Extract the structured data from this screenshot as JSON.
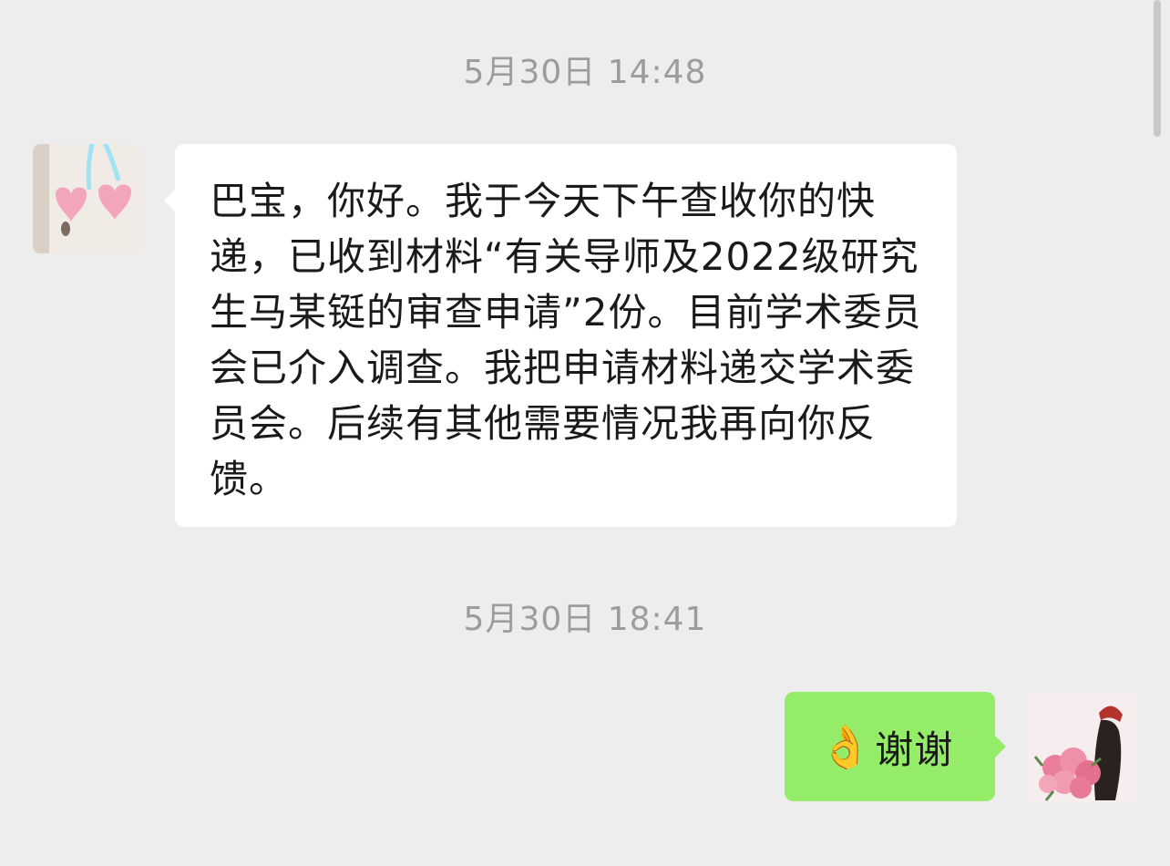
{
  "chat": {
    "messages": [
      {
        "timestamp": "5月30日 14:48",
        "direction": "incoming",
        "avatar": "cherry-bow-avatar",
        "text": "巴宝，你好。我于今天下午查收你的快递，已收到材料“有关导师及2022级研究生马某铤的审查申请”2份。目前学术委员会已介入调查。我把申请材料递交学术委员会。后续有其他需要情况我再向你反馈。"
      },
      {
        "timestamp": "5月30日 18:41",
        "direction": "outgoing",
        "avatar": "woman-with-flowers-avatar",
        "emoji": "👌",
        "text": "谢谢"
      }
    ]
  },
  "colors": {
    "background": "#ededed",
    "incoming_bubble": "#ffffff",
    "outgoing_bubble": "#95ec69",
    "timestamp_text": "#9c9c9c"
  }
}
